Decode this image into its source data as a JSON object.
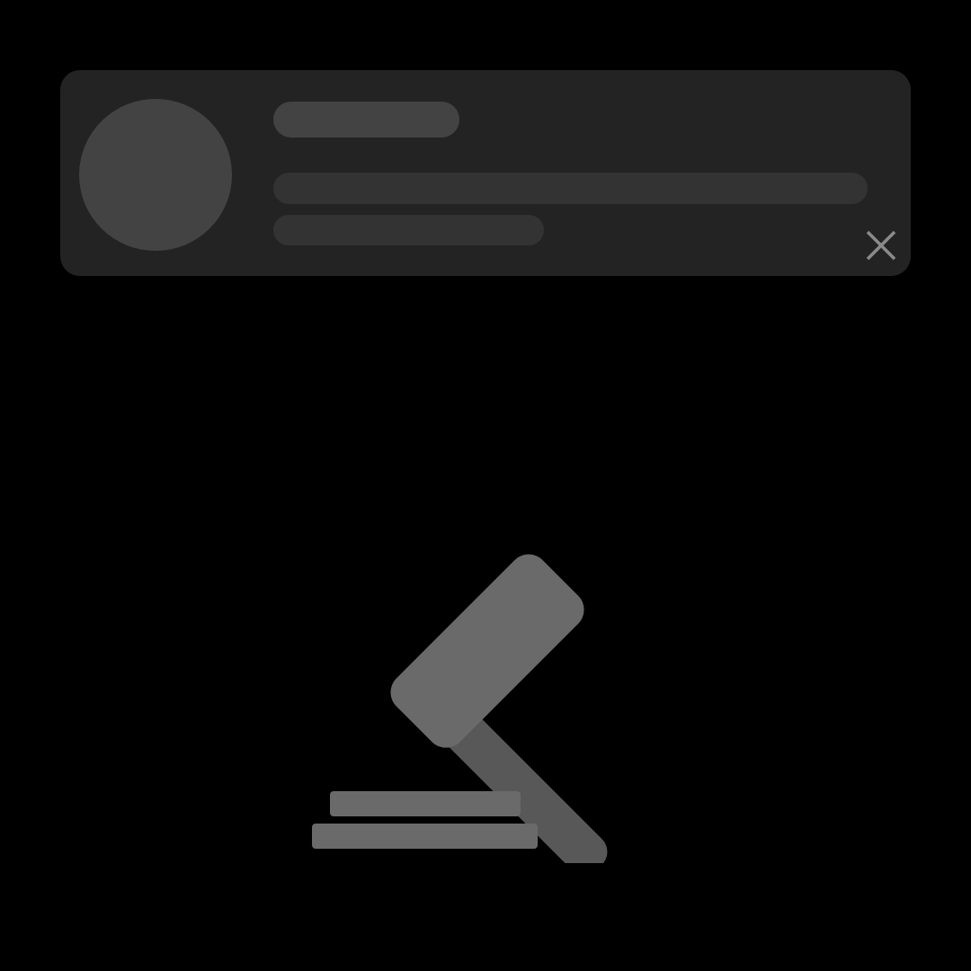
{
  "notification": {
    "avatar_icon": "avatar-placeholder",
    "close_icon": "close-icon"
  },
  "illustration": {
    "icon": "gavel-icon"
  },
  "colors": {
    "background": "#000000",
    "card": "#232323",
    "skeleton_strong": "#434343",
    "skeleton_soft": "#333333",
    "icon_light": "#6a6a6a",
    "icon_dark": "#585858",
    "close_icon": "#8a8a8a"
  }
}
